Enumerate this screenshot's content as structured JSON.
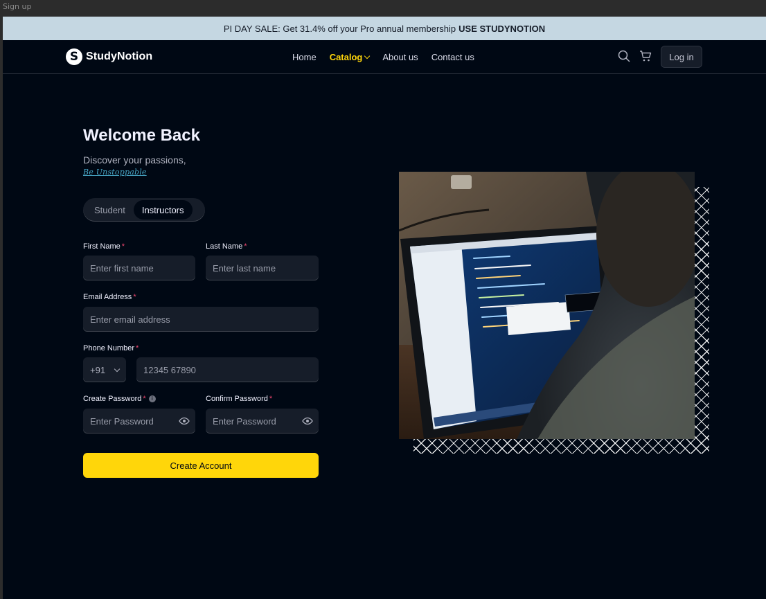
{
  "window_title": "Sign up",
  "banner": {
    "text": "PI DAY SALE: Get 31.4% off your Pro annual membership",
    "code": "USE STUDYNOTION"
  },
  "navbar": {
    "logo_mark": "S",
    "logo_text": "StudyNotion",
    "links": {
      "home": "Home",
      "catalog": "Catalog",
      "about": "About us",
      "contact": "Contact us"
    },
    "login_label": "Log in"
  },
  "hero": {
    "title": "Welcome Back",
    "subtitle": "Discover your passions,",
    "tagline": "Be Unstoppable"
  },
  "account_type": {
    "options": [
      "Student",
      "Instructors"
    ],
    "selected": "Instructors"
  },
  "form": {
    "first_name": {
      "label": "First Name",
      "placeholder": "Enter first name"
    },
    "last_name": {
      "label": "Last Name",
      "placeholder": "Enter last name"
    },
    "email": {
      "label": "Email Address",
      "placeholder": "Enter email address"
    },
    "phone": {
      "label": "Phone Number",
      "country_code": "+91",
      "placeholder": "12345 67890"
    },
    "create_password": {
      "label": "Create Password",
      "placeholder": "Enter Password"
    },
    "confirm_password": {
      "label": "Confirm Password",
      "placeholder": "Enter Password"
    },
    "required_mark": "*",
    "info_glyph": "i",
    "submit_label": "Create Account"
  },
  "colors": {
    "background": "#000814",
    "accent": "#ffd60a",
    "required": "#ef476f",
    "banner_bg": "#c5d7e2"
  }
}
